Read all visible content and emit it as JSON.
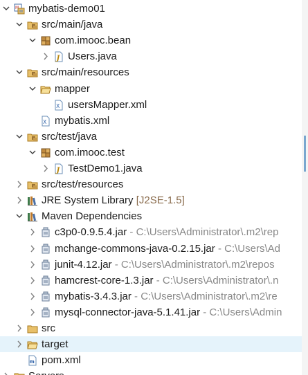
{
  "tree": [
    {
      "depth": 0,
      "state": "expanded",
      "icon": "maven-project-icon",
      "label": "mybatis-demo01"
    },
    {
      "depth": 1,
      "state": "expanded",
      "icon": "source-folder-icon",
      "label": "src/main/java"
    },
    {
      "depth": 2,
      "state": "expanded",
      "icon": "package-icon",
      "label": "com.imooc.bean"
    },
    {
      "depth": 3,
      "state": "collapsed",
      "icon": "java-file-icon",
      "label": "Users.java"
    },
    {
      "depth": 1,
      "state": "expanded",
      "icon": "source-folder-icon",
      "label": "src/main/resources"
    },
    {
      "depth": 2,
      "state": "expanded",
      "icon": "folder-open-icon",
      "label": "mapper"
    },
    {
      "depth": 3,
      "state": "leaf",
      "icon": "xml-file-icon",
      "label": "usersMapper.xml"
    },
    {
      "depth": 2,
      "state": "leaf",
      "icon": "xml-file-icon",
      "label": "mybatis.xml"
    },
    {
      "depth": 1,
      "state": "expanded",
      "icon": "source-folder-icon",
      "label": "src/test/java"
    },
    {
      "depth": 2,
      "state": "expanded",
      "icon": "package-icon",
      "label": "com.imooc.test"
    },
    {
      "depth": 3,
      "state": "collapsed",
      "icon": "java-file-icon",
      "label": "TestDemo1.java"
    },
    {
      "depth": 1,
      "state": "collapsed",
      "icon": "source-folder-icon",
      "label": "src/test/resources"
    },
    {
      "depth": 1,
      "state": "collapsed",
      "icon": "library-icon",
      "label": "JRE System Library",
      "decoration": "[J2SE-1.5]"
    },
    {
      "depth": 1,
      "state": "expanded",
      "icon": "library-icon",
      "label": "Maven Dependencies"
    },
    {
      "depth": 2,
      "state": "collapsed",
      "icon": "jar-icon",
      "label": "c3p0-0.9.5.4.jar",
      "path": " - C:\\Users\\Administrator\\.m2\\rep"
    },
    {
      "depth": 2,
      "state": "collapsed",
      "icon": "jar-icon",
      "label": "mchange-commons-java-0.2.15.jar",
      "path": " - C:\\Users\\Ad"
    },
    {
      "depth": 2,
      "state": "collapsed",
      "icon": "jar-icon",
      "label": "junit-4.12.jar",
      "path": " - C:\\Users\\Administrator\\.m2\\repos"
    },
    {
      "depth": 2,
      "state": "collapsed",
      "icon": "jar-icon",
      "label": "hamcrest-core-1.3.jar",
      "path": " - C:\\Users\\Administrator\\.n"
    },
    {
      "depth": 2,
      "state": "collapsed",
      "icon": "jar-icon",
      "label": "mybatis-3.4.3.jar",
      "path": " - C:\\Users\\Administrator\\.m2\\re"
    },
    {
      "depth": 2,
      "state": "collapsed",
      "icon": "jar-icon",
      "label": "mysql-connector-java-5.1.41.jar",
      "path": " - C:\\Users\\Admin"
    },
    {
      "depth": 1,
      "state": "collapsed",
      "icon": "folder-icon",
      "label": "src"
    },
    {
      "depth": 1,
      "state": "collapsed",
      "icon": "folder-open-icon",
      "label": "target",
      "selected": true
    },
    {
      "depth": 1,
      "state": "leaf",
      "icon": "pom-file-icon",
      "label": "pom.xml"
    },
    {
      "depth": 0,
      "state": "collapsed",
      "icon": "server-project-icon",
      "label": "Servers"
    }
  ],
  "colors": {
    "selection": "#e5f3fb",
    "decoration": "#8a6c4d",
    "path_text": "#888888",
    "scroll_thumb": "#7aa7cf"
  }
}
